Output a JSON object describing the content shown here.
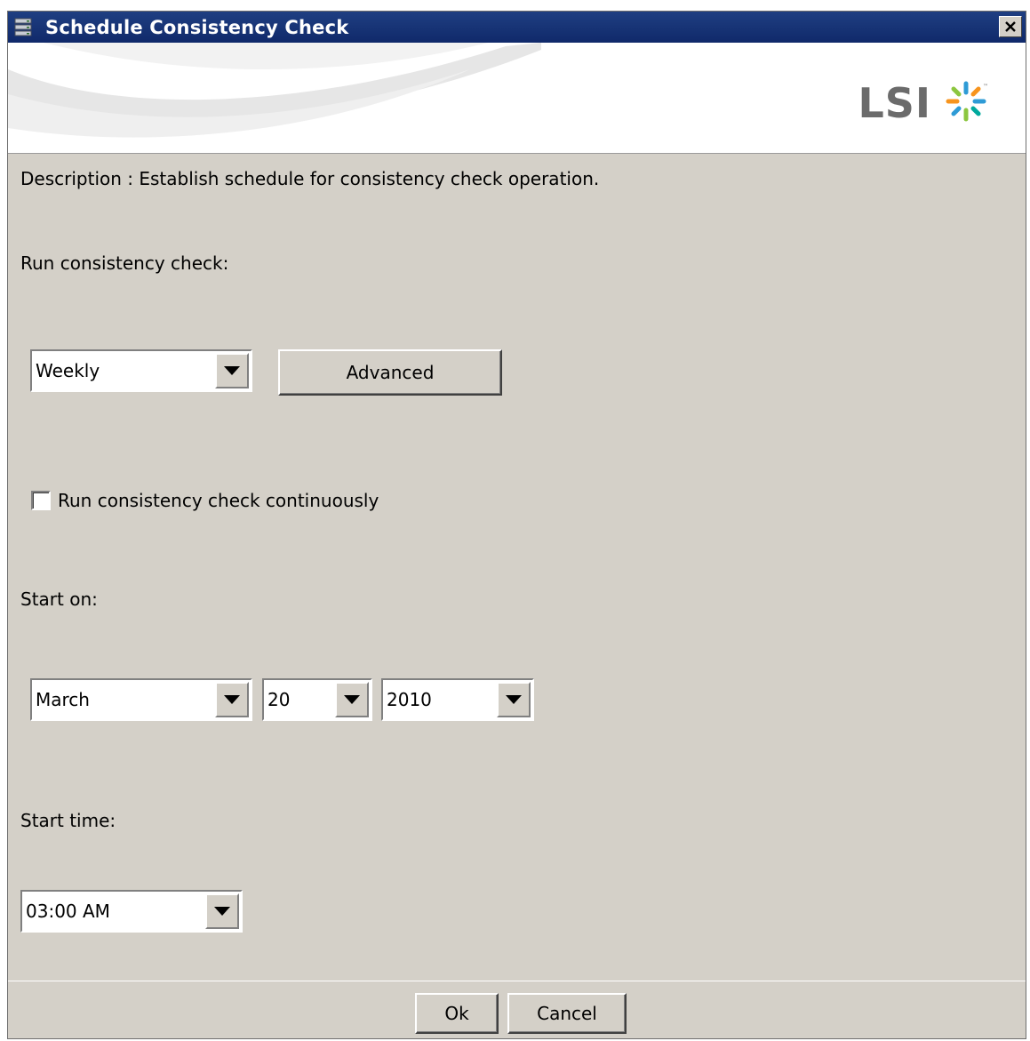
{
  "window": {
    "title": "Schedule Consistency Check",
    "close_icon": "close-icon"
  },
  "banner": {
    "logo_text": "LSI",
    "logo_icon": "lsi-starburst-icon"
  },
  "form": {
    "description": "Description : Establish schedule for consistency check operation.",
    "run_label": "Run consistency check:",
    "frequency_value": "Weekly",
    "advanced_label": "Advanced",
    "continuous_label": "Run consistency check continuously",
    "continuous_checked": false,
    "start_on_label": "Start on:",
    "month_value": "March",
    "day_value": "20",
    "year_value": "2010",
    "start_time_label": "Start time:",
    "time_value": "03:00 AM"
  },
  "footer": {
    "ok_label": "Ok",
    "cancel_label": "Cancel"
  },
  "colors": {
    "titlebar": "#10296a",
    "dialog_bg": "#d4d0c8",
    "logo_text": "#6b6b6b"
  }
}
